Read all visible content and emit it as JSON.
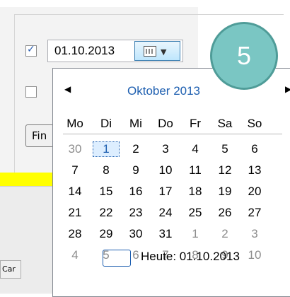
{
  "date_picker": {
    "value": "01.10.2013",
    "checked": true
  },
  "second_checkbox": {
    "checked": false
  },
  "find_button_label": "Fin",
  "cancel_button_label": "Car",
  "calendar": {
    "prev_icon": "triangle-left-icon",
    "next_icon": "triangle-right-icon",
    "month_title": "Oktober 2013",
    "weekdays": [
      "Mo",
      "Di",
      "Mi",
      "Do",
      "Fr",
      "Sa",
      "So"
    ],
    "weeks": [
      [
        "30",
        "1",
        "2",
        "3",
        "4",
        "5",
        "6"
      ],
      [
        "7",
        "8",
        "9",
        "10",
        "11",
        "12",
        "13"
      ],
      [
        "14",
        "15",
        "16",
        "17",
        "18",
        "19",
        "20"
      ],
      [
        "21",
        "22",
        "23",
        "24",
        "25",
        "26",
        "27"
      ],
      [
        "28",
        "29",
        "30",
        "31",
        "1",
        "2",
        "3"
      ],
      [
        "4",
        "5",
        "6",
        "7",
        "8",
        "9",
        "10"
      ]
    ],
    "selected_day": "1",
    "today_label": "Heute: 01.10.2013"
  },
  "badge_number": "5",
  "colors": {
    "accent": "#1e5fb0",
    "badge_fill": "#7ac6c3",
    "highlight": "#ffff00"
  }
}
